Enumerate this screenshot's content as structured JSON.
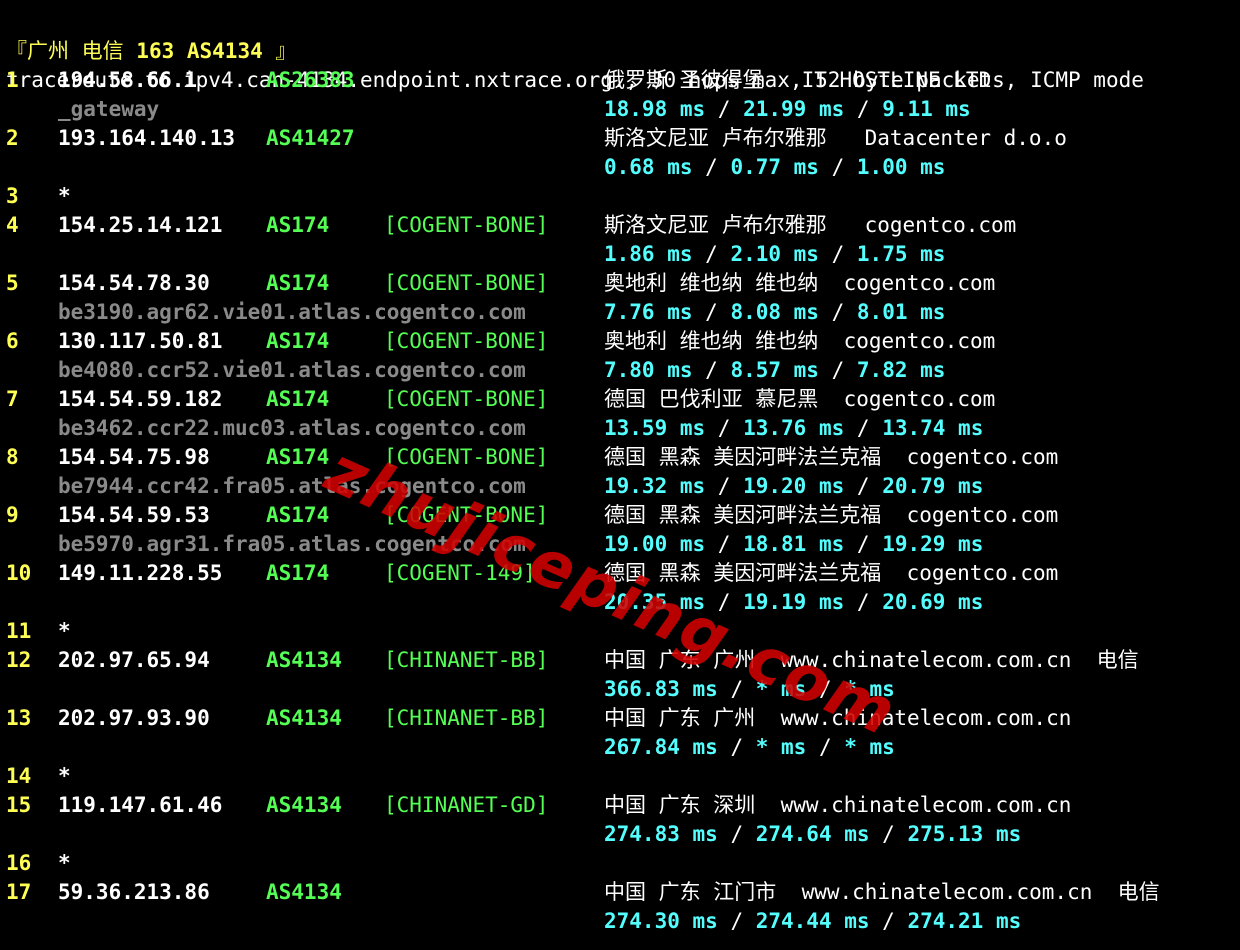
{
  "title": {
    "prefix": "『广州 电信 ",
    "bold": "163 AS4134",
    "suffix": " 』"
  },
  "command": "traceroute to ipv4.can-4134.endpoint.nxtrace.org., 30 hops max, 52 byte packets, ICMP mode",
  "rtt_separator": " / ",
  "hops": [
    {
      "hop": "1",
      "ip": "194.58.66.1",
      "as": "AS26383",
      "tag": "",
      "geo": "俄罗斯 圣彼得堡   IT HOSTLINE LTD",
      "host": "_gateway",
      "rtt": [
        "18.98 ms",
        "21.99 ms",
        "9.11 ms"
      ]
    },
    {
      "hop": "2",
      "ip": "193.164.140.13",
      "as": "AS41427",
      "tag": "",
      "geo": "斯洛文尼亚 卢布尔雅那   Datacenter d.o.o",
      "host": "",
      "rtt": [
        "0.68 ms",
        "0.77 ms",
        "1.00 ms"
      ]
    },
    {
      "hop": "3",
      "ip": "*"
    },
    {
      "hop": "4",
      "ip": "154.25.14.121",
      "as": "AS174",
      "tag": "[COGENT-BONE]",
      "geo": "斯洛文尼亚 卢布尔雅那   cogentco.com",
      "host": "",
      "rtt": [
        "1.86 ms",
        "2.10 ms",
        "1.75 ms"
      ]
    },
    {
      "hop": "5",
      "ip": "154.54.78.30",
      "as": "AS174",
      "tag": "[COGENT-BONE]",
      "geo": "奥地利 维也纳 维也纳  cogentco.com",
      "host": "be3190.agr62.vie01.atlas.cogentco.com",
      "rtt": [
        "7.76 ms",
        "8.08 ms",
        "8.01 ms"
      ]
    },
    {
      "hop": "6",
      "ip": "130.117.50.81",
      "as": "AS174",
      "tag": "[COGENT-BONE]",
      "geo": "奥地利 维也纳 维也纳  cogentco.com",
      "host": "be4080.ccr52.vie01.atlas.cogentco.com",
      "rtt": [
        "7.80 ms",
        "8.57 ms",
        "7.82 ms"
      ]
    },
    {
      "hop": "7",
      "ip": "154.54.59.182",
      "as": "AS174",
      "tag": "[COGENT-BONE]",
      "geo": "德国 巴伐利亚 慕尼黑  cogentco.com",
      "host": "be3462.ccr22.muc03.atlas.cogentco.com",
      "rtt": [
        "13.59 ms",
        "13.76 ms",
        "13.74 ms"
      ]
    },
    {
      "hop": "8",
      "ip": "154.54.75.98",
      "as": "AS174",
      "tag": "[COGENT-BONE]",
      "geo": "德国 黑森 美因河畔法兰克福  cogentco.com",
      "host": "be7944.ccr42.fra05.atlas.cogentco.com",
      "rtt": [
        "19.32 ms",
        "19.20 ms",
        "20.79 ms"
      ]
    },
    {
      "hop": "9",
      "ip": "154.54.59.53",
      "as": "AS174",
      "tag": "[COGENT-BONE]",
      "geo": "德国 黑森 美因河畔法兰克福  cogentco.com",
      "host": "be5970.agr31.fra05.atlas.cogentco.com",
      "rtt": [
        "19.00 ms",
        "18.81 ms",
        "19.29 ms"
      ]
    },
    {
      "hop": "10",
      "ip": "149.11.228.55",
      "as": "AS174",
      "tag": "[COGENT-149]",
      "geo": "德国 黑森 美因河畔法兰克福  cogentco.com",
      "host": "",
      "rtt": [
        "20.35 ms",
        "19.19 ms",
        "20.69 ms"
      ]
    },
    {
      "hop": "11",
      "ip": "*"
    },
    {
      "hop": "12",
      "ip": "202.97.65.94",
      "as": "AS4134",
      "tag": "[CHINANET-BB]",
      "geo": "中国 广东 广州  www.chinatelecom.com.cn  电信",
      "host": "",
      "rtt": [
        "366.83 ms",
        "* ms",
        "* ms"
      ]
    },
    {
      "hop": "13",
      "ip": "202.97.93.90",
      "as": "AS4134",
      "tag": "[CHINANET-BB]",
      "geo": "中国 广东 广州  www.chinatelecom.com.cn",
      "host": "",
      "rtt": [
        "267.84 ms",
        "* ms",
        "* ms"
      ]
    },
    {
      "hop": "14",
      "ip": "*"
    },
    {
      "hop": "15",
      "ip": "119.147.61.46",
      "as": "AS4134",
      "tag": "[CHINANET-GD]",
      "geo": "中国 广东 深圳  www.chinatelecom.com.cn",
      "host": "",
      "rtt": [
        "274.83 ms",
        "274.64 ms",
        "275.13 ms"
      ]
    },
    {
      "hop": "16",
      "ip": "*"
    },
    {
      "hop": "17",
      "ip": "59.36.213.86",
      "as": "AS4134",
      "tag": "",
      "geo": "中国 广东 江门市  www.chinatelecom.com.cn  电信",
      "host": "",
      "rtt": [
        "274.30 ms",
        "274.44 ms",
        "274.21 ms"
      ]
    }
  ],
  "watermark": "zhujiceping.com",
  "colors": {
    "background": "#000000",
    "hop_number": "#fefe54",
    "ip": "#ffffff",
    "hostname": "#8a8a8a",
    "asn": "#54fe54",
    "rtt": "#54fefe",
    "watermark": "#d20000"
  }
}
